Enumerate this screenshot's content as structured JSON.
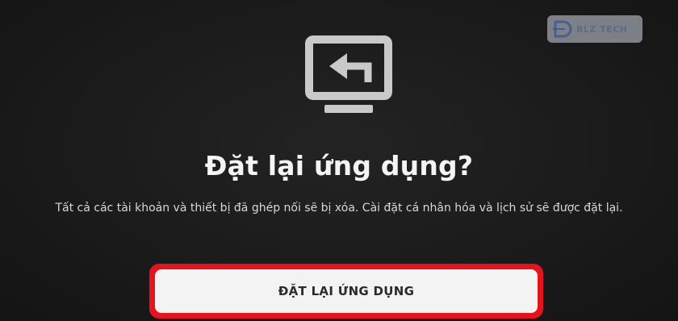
{
  "watermark": {
    "text": "BLZ TECH",
    "icon": "blz-tech-logo"
  },
  "dialog": {
    "icon": "monitor-back-arrow-icon",
    "title": "Đặt lại ứng dụng?",
    "message": "Tất cả các tài khoản và thiết bị đã ghép nối sẽ bị xóa. Cài đặt cá nhân hóa và lịch sử sẽ được đặt lại.",
    "reset_button_label": "ĐẶT LẠI ỨNG DỤNG",
    "focus_color": "#e3141d"
  }
}
